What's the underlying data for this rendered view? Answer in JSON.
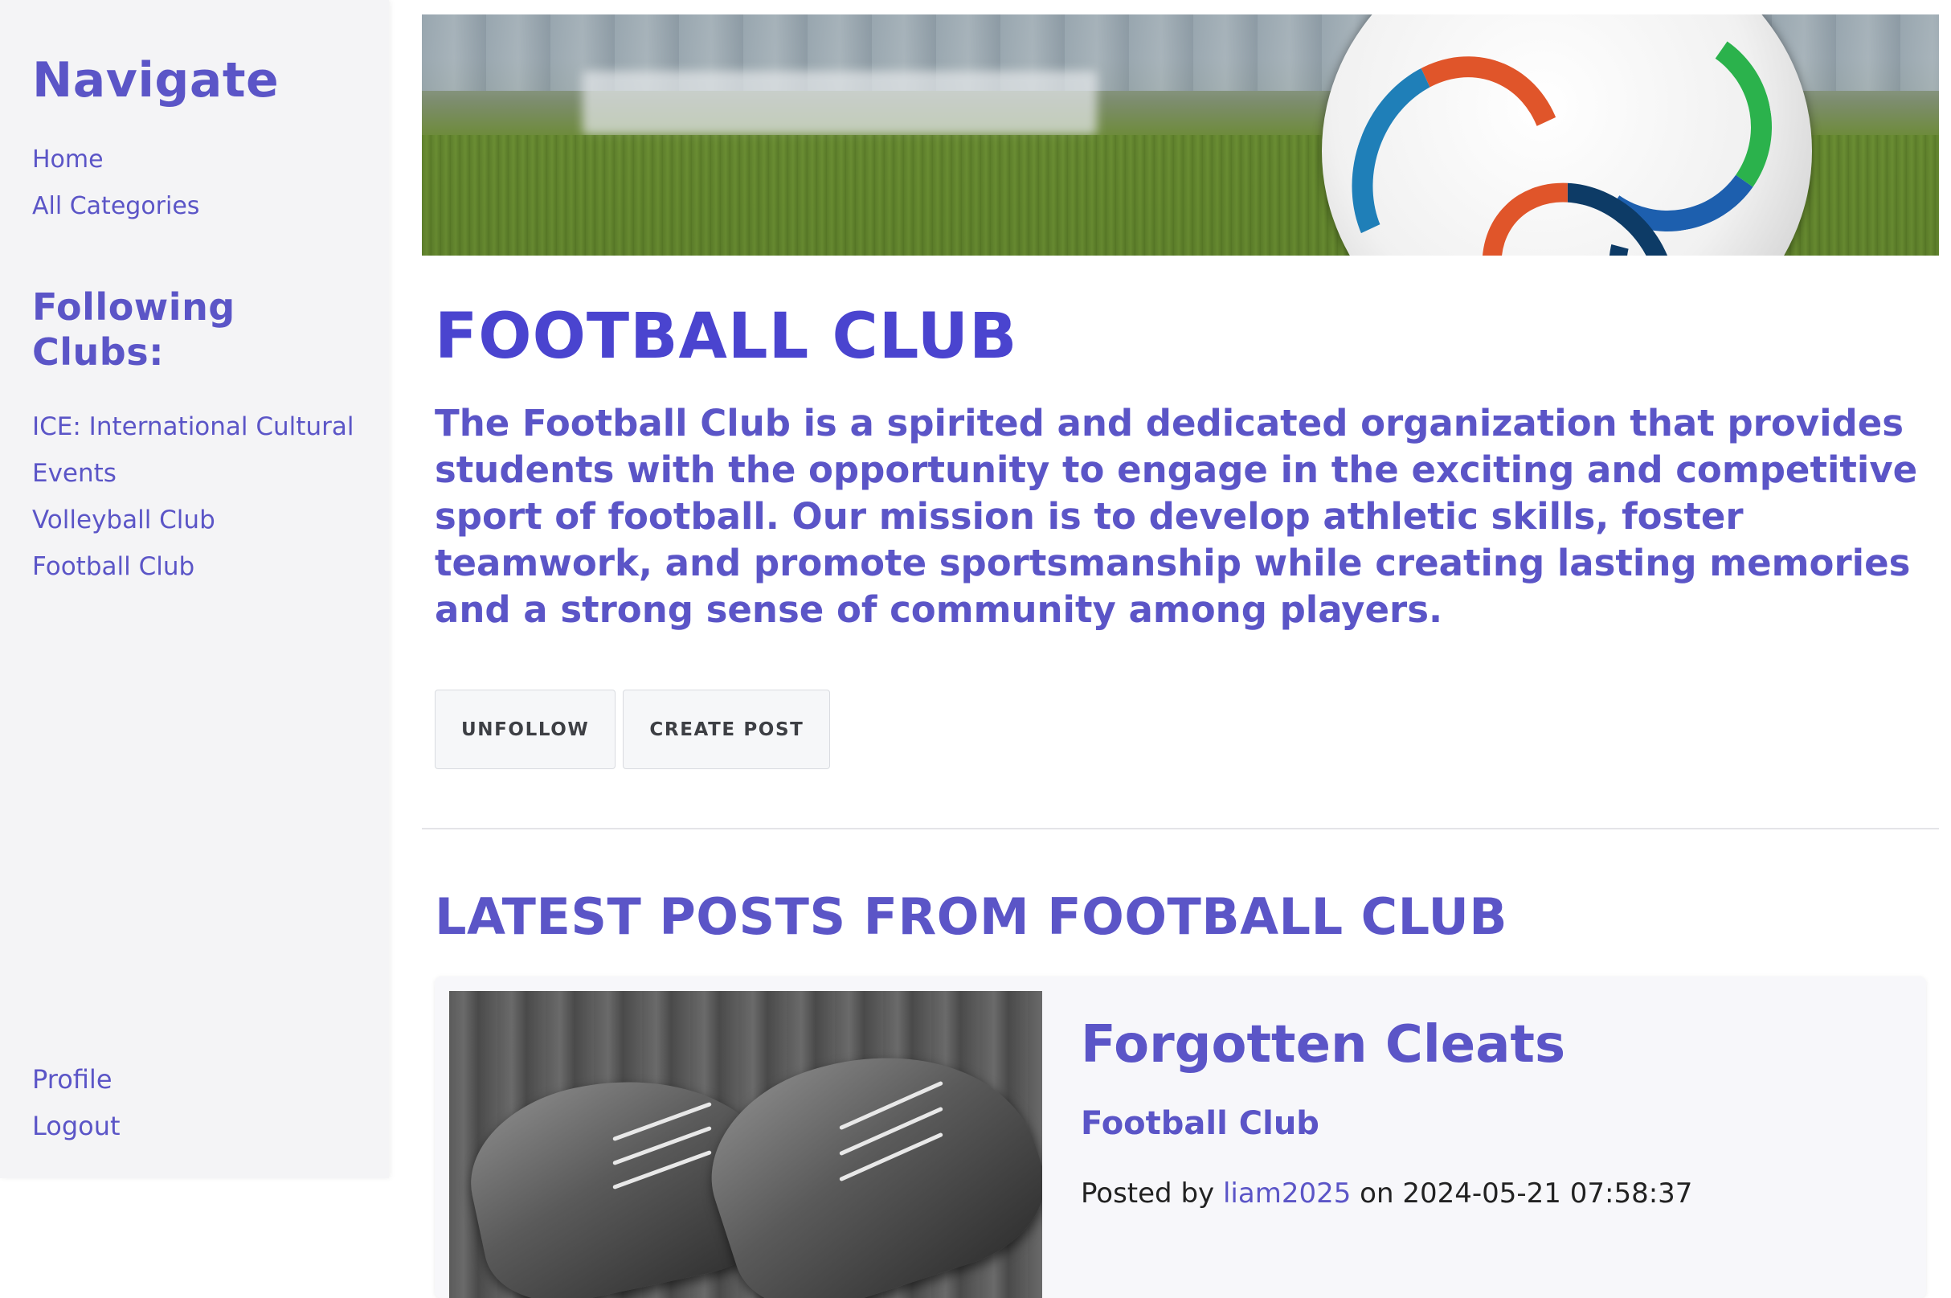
{
  "sidebar": {
    "title": "Navigate",
    "nav": [
      {
        "label": "Home"
      },
      {
        "label": "All Categories"
      }
    ],
    "following_title": "Following Clubs:",
    "clubs": [
      {
        "label": "ICE: International Cultural Events"
      },
      {
        "label": "Volleyball Club"
      },
      {
        "label": "Football Club"
      }
    ],
    "bottom": [
      {
        "label": "Profile"
      },
      {
        "label": "Logout"
      }
    ]
  },
  "club": {
    "title": "FOOTBALL CLUB",
    "description": "The Football Club is a spirited and dedicated organization that provides students with the opportunity to engage in the exciting and competitive sport of football. Our mission is to develop athletic skills, foster teamwork, and promote sportsmanship while creating lasting memories and a strong sense of community among players.",
    "unfollow_label": "UNFOLLOW",
    "create_post_label": "CREATE POST"
  },
  "latest": {
    "title": "LATEST POSTS FROM FOOTBALL CLUB",
    "posts": [
      {
        "title": "Forgotten Cleats",
        "club": "Football Club",
        "posted_by_prefix": "Posted by",
        "author": "liam2025",
        "separator": "on",
        "timestamp": "2024-05-21 07:58:37"
      }
    ]
  },
  "colors": {
    "accent": "#5b55c7",
    "title_accent": "#4a44cf",
    "sidebar_bg": "#f4f4f6"
  }
}
